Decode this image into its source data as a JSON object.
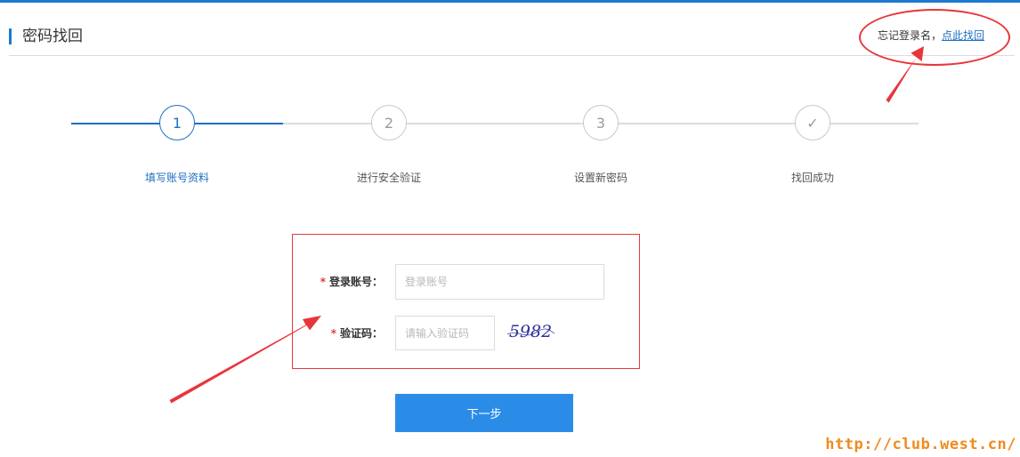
{
  "header": {
    "title": "密码找回",
    "forgot_text": "忘记登录名，",
    "forgot_link": "点此找回"
  },
  "steps": [
    {
      "number": "1",
      "label": "填写账号资料",
      "active": true
    },
    {
      "number": "2",
      "label": "进行安全验证",
      "active": false
    },
    {
      "number": "3",
      "label": "设置新密码",
      "active": false
    },
    {
      "number": "✓",
      "label": "找回成功",
      "active": false
    }
  ],
  "form": {
    "account_label": "登录账号：",
    "account_placeholder": "登录账号",
    "captcha_label": "验证码：",
    "captcha_placeholder": "请输入验证码",
    "captcha_text": "5982",
    "required_mark": "*"
  },
  "next_button_label": "下一步",
  "watermark": "http://club.west.cn/",
  "colors": {
    "accent": "#1e7ad0",
    "button": "#2b8ce8",
    "annotation": "#e7363a",
    "watermark": "#f28a1e"
  }
}
